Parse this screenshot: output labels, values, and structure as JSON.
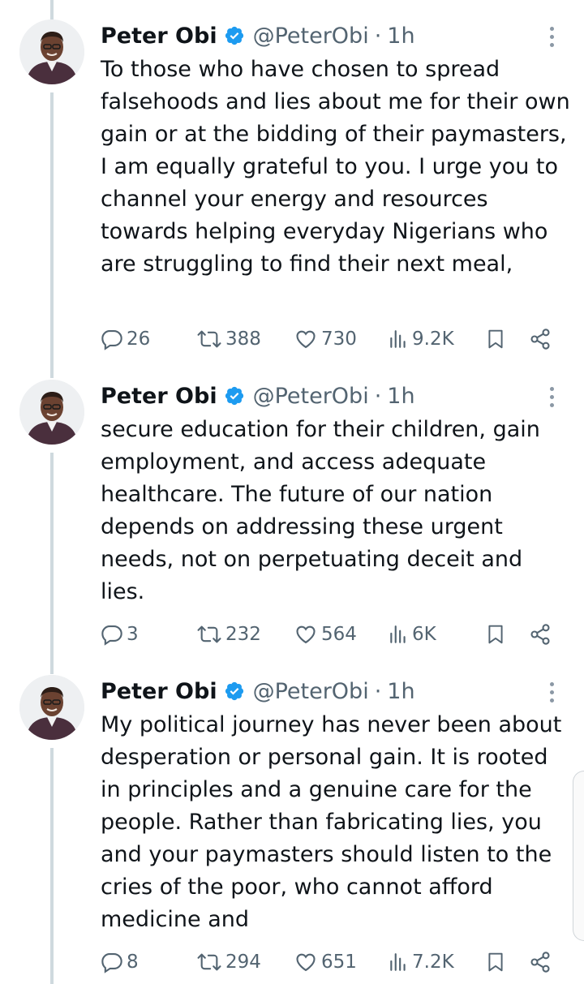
{
  "tweets": [
    {
      "author": "Peter Obi",
      "handle": "@PeterObi",
      "separator": "·",
      "time": "1h",
      "text": "To those who have chosen to spread falsehoods and lies about me for their own gain or at the bidding of their paymasters, I am equally grateful to you. I urge you to channel your energy and resources towards helping everyday Nigerians who are struggling to find their next meal,",
      "replies": "26",
      "reposts": "388",
      "likes": "730",
      "views": "9.2K"
    },
    {
      "author": "Peter Obi",
      "handle": "@PeterObi",
      "separator": "·",
      "time": "1h",
      "text": "secure education for their children, gain employment, and access adequate healthcare. The future of our nation depends on addressing these urgent needs, not on perpetuating deceit and lies.",
      "replies": "3",
      "reposts": "232",
      "likes": "564",
      "views": "6K"
    },
    {
      "author": "Peter Obi",
      "handle": "@PeterObi",
      "separator": "·",
      "time": "1h",
      "text": "My political journey has never been about desperation or personal gain. It is rooted in principles and a genuine care for the people. Rather than fabricating lies, you and your paymasters should listen to the cries of the poor, who cannot afford medicine and",
      "replies": "8",
      "reposts": "294",
      "likes": "651",
      "views": "7.2K"
    }
  ],
  "icons": {
    "verified": "verified-badge-icon",
    "reply": "reply-icon",
    "repost": "repost-icon",
    "like": "like-icon",
    "views": "views-icon",
    "bookmark": "bookmark-icon",
    "share": "share-icon",
    "more": "more-options-icon"
  },
  "colors": {
    "verified": "#1d9bf0",
    "muted": "#536471",
    "text": "#0f1419",
    "thread_line": "#cfd9de"
  }
}
